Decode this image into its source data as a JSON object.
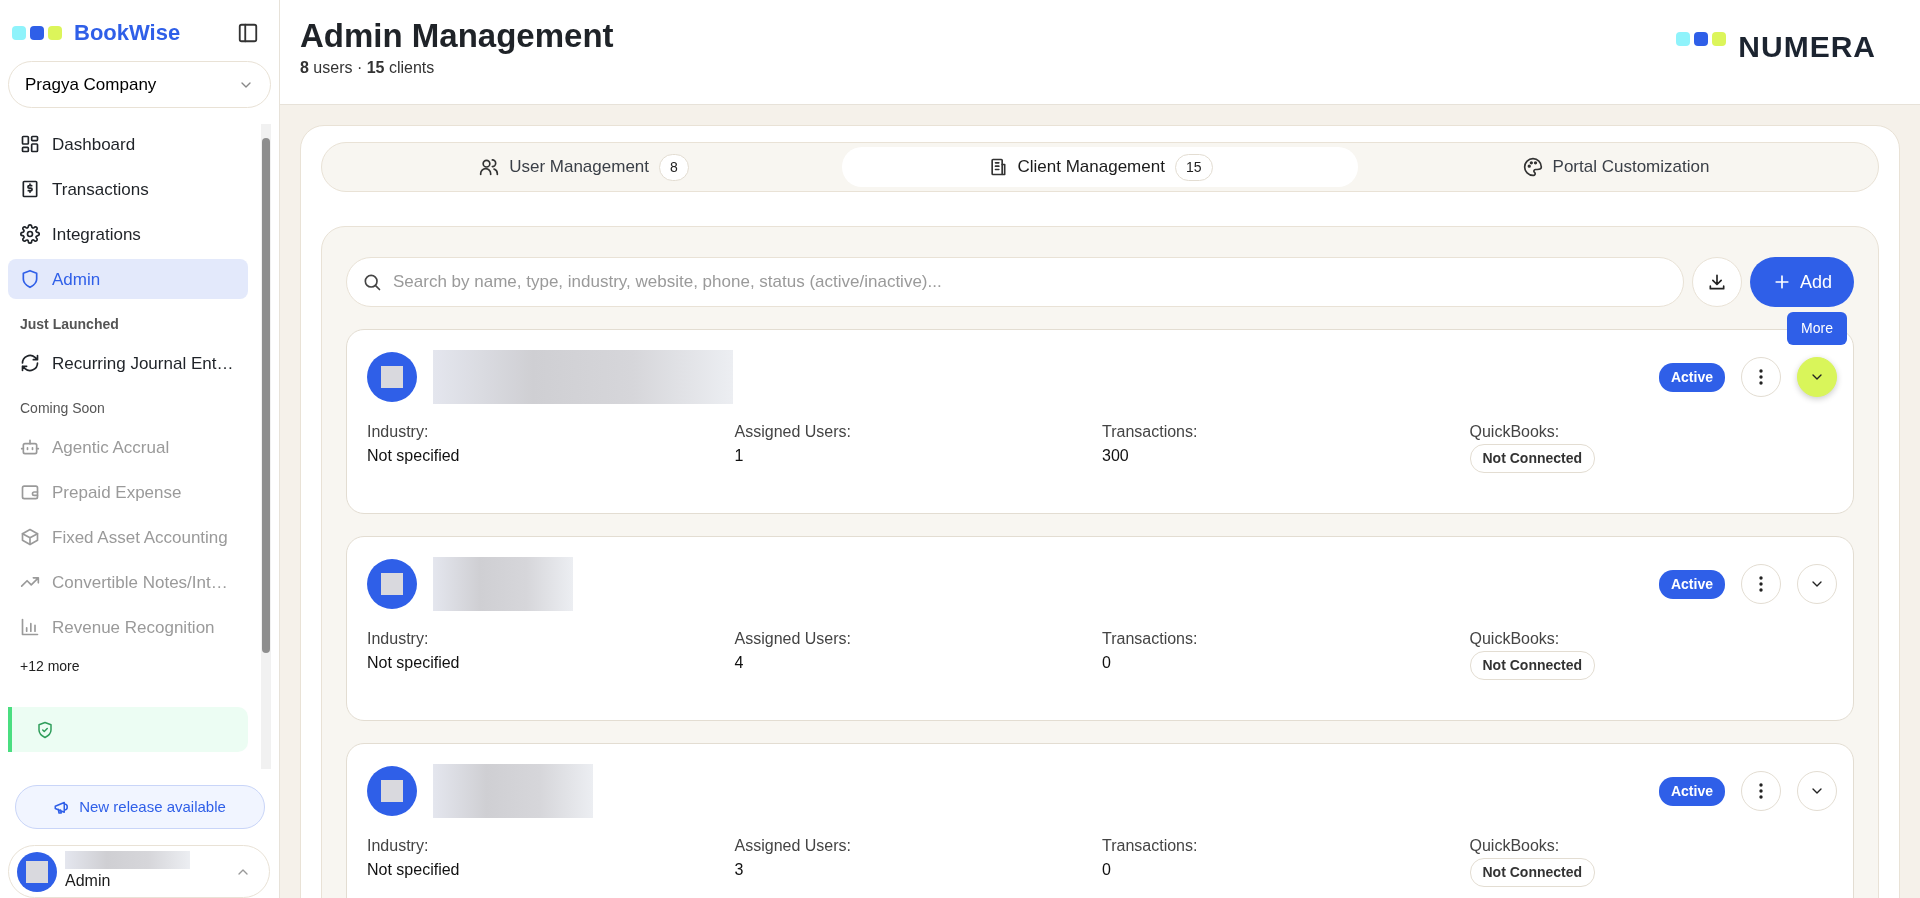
{
  "sidebar": {
    "brand": "BookWise",
    "company": "Pragya Company",
    "sections": [
      {
        "items": [
          {
            "label": "Dashboard",
            "selected": false,
            "disabled": false
          },
          {
            "label": "Transactions",
            "selected": false,
            "disabled": false
          },
          {
            "label": "Integrations",
            "selected": false,
            "disabled": false
          },
          {
            "label": "Admin",
            "selected": true,
            "disabled": false
          }
        ]
      },
      {
        "heading": "Just Launched",
        "heading_bold": true,
        "items": [
          {
            "label": "Recurring Journal Ent…",
            "selected": false,
            "disabled": false
          }
        ]
      },
      {
        "heading": "Coming Soon",
        "heading_bold": false,
        "items": [
          {
            "label": "Agentic Accrual",
            "selected": false,
            "disabled": true
          },
          {
            "label": "Prepaid Expense",
            "selected": false,
            "disabled": true
          },
          {
            "label": "Fixed Asset Accounting",
            "selected": false,
            "disabled": true
          },
          {
            "label": "Convertible Notes/Int…",
            "selected": false,
            "disabled": true
          },
          {
            "label": "Revenue Recognition",
            "selected": false,
            "disabled": true
          }
        ]
      }
    ],
    "more": "+12 more",
    "release_button": "New release available",
    "user": {
      "role": "Admin"
    }
  },
  "header": {
    "title": "Admin Management",
    "summary": "**8** users · **15** clients",
    "logo": "NUMERA"
  },
  "tabs": [
    {
      "label": "User Management",
      "count": "8",
      "selected": false
    },
    {
      "label": "Client Management",
      "count": "15",
      "selected": true
    },
    {
      "label": "Portal Customization",
      "selected": false
    }
  ],
  "search": {
    "placeholder": "Search by name, type, industry, website, phone, status (active/inactive)..."
  },
  "add_button": "Add",
  "clients": [
    {
      "status": "Active",
      "tooltip": "More",
      "fields": [
        {
          "label": "Industry:",
          "value": "Not specified",
          "kind": "text"
        },
        {
          "label": "Assigned Users:",
          "value": "1",
          "kind": "text"
        },
        {
          "label": "Transactions:",
          "value": "300",
          "kind": "text"
        },
        {
          "label": "QuickBooks:",
          "value": "Not Connected",
          "kind": "badge"
        }
      ]
    },
    {
      "status": "Active",
      "fields": [
        {
          "label": "Industry:",
          "value": "Not specified",
          "kind": "text"
        },
        {
          "label": "Assigned Users:",
          "value": "4",
          "kind": "text"
        },
        {
          "label": "Transactions:",
          "value": "0",
          "kind": "text"
        },
        {
          "label": "QuickBooks:",
          "value": "Not Connected",
          "kind": "badge"
        }
      ]
    },
    {
      "status": "Active",
      "fields": [
        {
          "label": "Industry:",
          "value": "Not specified",
          "kind": "text"
        },
        {
          "label": "Assigned Users:",
          "value": "3",
          "kind": "text"
        },
        {
          "label": "Transactions:",
          "value": "0",
          "kind": "text"
        },
        {
          "label": "QuickBooks:",
          "value": "Not Connected",
          "kind": "badge"
        }
      ]
    }
  ]
}
